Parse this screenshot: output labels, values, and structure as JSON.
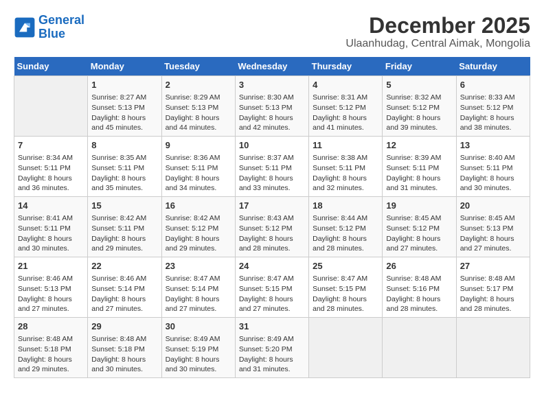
{
  "logo": {
    "line1": "General",
    "line2": "Blue"
  },
  "title": "December 2025",
  "subtitle": "Ulaanhudag, Central Aimak, Mongolia",
  "days_of_week": [
    "Sunday",
    "Monday",
    "Tuesday",
    "Wednesday",
    "Thursday",
    "Friday",
    "Saturday"
  ],
  "weeks": [
    [
      {
        "day": "",
        "info": ""
      },
      {
        "day": "1",
        "info": "Sunrise: 8:27 AM\nSunset: 5:13 PM\nDaylight: 8 hours and 45 minutes."
      },
      {
        "day": "2",
        "info": "Sunrise: 8:29 AM\nSunset: 5:13 PM\nDaylight: 8 hours and 44 minutes."
      },
      {
        "day": "3",
        "info": "Sunrise: 8:30 AM\nSunset: 5:13 PM\nDaylight: 8 hours and 42 minutes."
      },
      {
        "day": "4",
        "info": "Sunrise: 8:31 AM\nSunset: 5:12 PM\nDaylight: 8 hours and 41 minutes."
      },
      {
        "day": "5",
        "info": "Sunrise: 8:32 AM\nSunset: 5:12 PM\nDaylight: 8 hours and 39 minutes."
      },
      {
        "day": "6",
        "info": "Sunrise: 8:33 AM\nSunset: 5:12 PM\nDaylight: 8 hours and 38 minutes."
      }
    ],
    [
      {
        "day": "7",
        "info": "Sunrise: 8:34 AM\nSunset: 5:11 PM\nDaylight: 8 hours and 36 minutes."
      },
      {
        "day": "8",
        "info": "Sunrise: 8:35 AM\nSunset: 5:11 PM\nDaylight: 8 hours and 35 minutes."
      },
      {
        "day": "9",
        "info": "Sunrise: 8:36 AM\nSunset: 5:11 PM\nDaylight: 8 hours and 34 minutes."
      },
      {
        "day": "10",
        "info": "Sunrise: 8:37 AM\nSunset: 5:11 PM\nDaylight: 8 hours and 33 minutes."
      },
      {
        "day": "11",
        "info": "Sunrise: 8:38 AM\nSunset: 5:11 PM\nDaylight: 8 hours and 32 minutes."
      },
      {
        "day": "12",
        "info": "Sunrise: 8:39 AM\nSunset: 5:11 PM\nDaylight: 8 hours and 31 minutes."
      },
      {
        "day": "13",
        "info": "Sunrise: 8:40 AM\nSunset: 5:11 PM\nDaylight: 8 hours and 30 minutes."
      }
    ],
    [
      {
        "day": "14",
        "info": "Sunrise: 8:41 AM\nSunset: 5:11 PM\nDaylight: 8 hours and 30 minutes."
      },
      {
        "day": "15",
        "info": "Sunrise: 8:42 AM\nSunset: 5:11 PM\nDaylight: 8 hours and 29 minutes."
      },
      {
        "day": "16",
        "info": "Sunrise: 8:42 AM\nSunset: 5:12 PM\nDaylight: 8 hours and 29 minutes."
      },
      {
        "day": "17",
        "info": "Sunrise: 8:43 AM\nSunset: 5:12 PM\nDaylight: 8 hours and 28 minutes."
      },
      {
        "day": "18",
        "info": "Sunrise: 8:44 AM\nSunset: 5:12 PM\nDaylight: 8 hours and 28 minutes."
      },
      {
        "day": "19",
        "info": "Sunrise: 8:45 AM\nSunset: 5:12 PM\nDaylight: 8 hours and 27 minutes."
      },
      {
        "day": "20",
        "info": "Sunrise: 8:45 AM\nSunset: 5:13 PM\nDaylight: 8 hours and 27 minutes."
      }
    ],
    [
      {
        "day": "21",
        "info": "Sunrise: 8:46 AM\nSunset: 5:13 PM\nDaylight: 8 hours and 27 minutes."
      },
      {
        "day": "22",
        "info": "Sunrise: 8:46 AM\nSunset: 5:14 PM\nDaylight: 8 hours and 27 minutes."
      },
      {
        "day": "23",
        "info": "Sunrise: 8:47 AM\nSunset: 5:14 PM\nDaylight: 8 hours and 27 minutes."
      },
      {
        "day": "24",
        "info": "Sunrise: 8:47 AM\nSunset: 5:15 PM\nDaylight: 8 hours and 27 minutes."
      },
      {
        "day": "25",
        "info": "Sunrise: 8:47 AM\nSunset: 5:15 PM\nDaylight: 8 hours and 28 minutes."
      },
      {
        "day": "26",
        "info": "Sunrise: 8:48 AM\nSunset: 5:16 PM\nDaylight: 8 hours and 28 minutes."
      },
      {
        "day": "27",
        "info": "Sunrise: 8:48 AM\nSunset: 5:17 PM\nDaylight: 8 hours and 28 minutes."
      }
    ],
    [
      {
        "day": "28",
        "info": "Sunrise: 8:48 AM\nSunset: 5:18 PM\nDaylight: 8 hours and 29 minutes."
      },
      {
        "day": "29",
        "info": "Sunrise: 8:48 AM\nSunset: 5:18 PM\nDaylight: 8 hours and 30 minutes."
      },
      {
        "day": "30",
        "info": "Sunrise: 8:49 AM\nSunset: 5:19 PM\nDaylight: 8 hours and 30 minutes."
      },
      {
        "day": "31",
        "info": "Sunrise: 8:49 AM\nSunset: 5:20 PM\nDaylight: 8 hours and 31 minutes."
      },
      {
        "day": "",
        "info": ""
      },
      {
        "day": "",
        "info": ""
      },
      {
        "day": "",
        "info": ""
      }
    ]
  ]
}
